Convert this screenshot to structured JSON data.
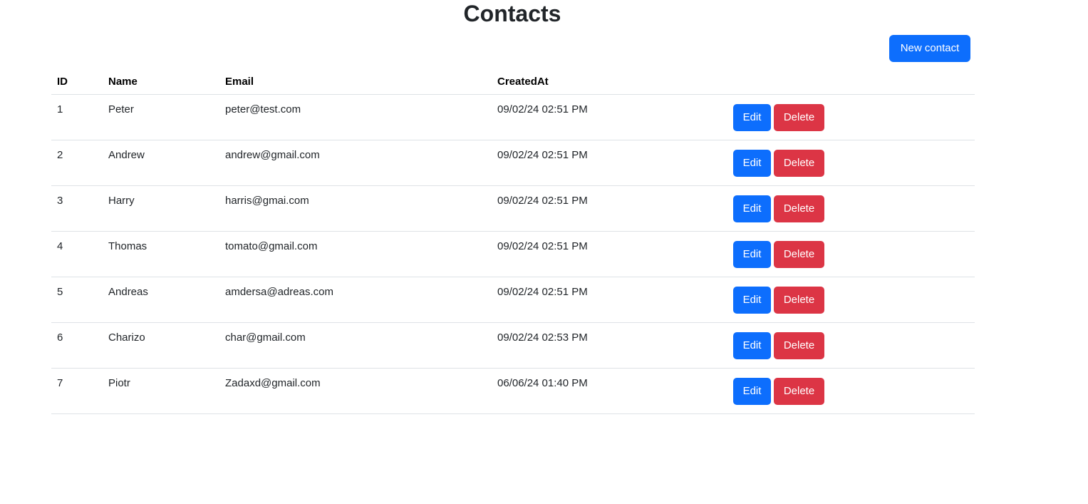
{
  "page": {
    "title": "Contacts",
    "new_contact_label": "New contact"
  },
  "table": {
    "headers": {
      "id": "ID",
      "name": "Name",
      "email": "Email",
      "created_at": "CreatedAt",
      "actions": ""
    },
    "rows": [
      {
        "id": "1",
        "name": "Peter",
        "email": "peter@test.com",
        "created_at": "09/02/24 02:51 PM",
        "edit_label": "Edit",
        "delete_label": "Delete"
      },
      {
        "id": "2",
        "name": "Andrew",
        "email": "andrew@gmail.com",
        "created_at": "09/02/24 02:51 PM",
        "edit_label": "Edit",
        "delete_label": "Delete"
      },
      {
        "id": "3",
        "name": "Harry",
        "email": "harris@gmai.com",
        "created_at": "09/02/24 02:51 PM",
        "edit_label": "Edit",
        "delete_label": "Delete"
      },
      {
        "id": "4",
        "name": "Thomas",
        "email": "tomato@gmail.com",
        "created_at": "09/02/24 02:51 PM",
        "edit_label": "Edit",
        "delete_label": "Delete"
      },
      {
        "id": "5",
        "name": "Andreas",
        "email": "amdersa@adreas.com",
        "created_at": "09/02/24 02:51 PM",
        "edit_label": "Edit",
        "delete_label": "Delete"
      },
      {
        "id": "6",
        "name": "Charizo",
        "email": "char@gmail.com",
        "created_at": "09/02/24 02:53 PM",
        "edit_label": "Edit",
        "delete_label": "Delete"
      },
      {
        "id": "7",
        "name": "Piotr",
        "email": "Zadaxd@gmail.com",
        "created_at": "06/06/24 01:40 PM",
        "edit_label": "Edit",
        "delete_label": "Delete"
      }
    ]
  },
  "colors": {
    "primary": "#0d6efd",
    "danger": "#dc3545",
    "divider": "#dee2e6"
  }
}
